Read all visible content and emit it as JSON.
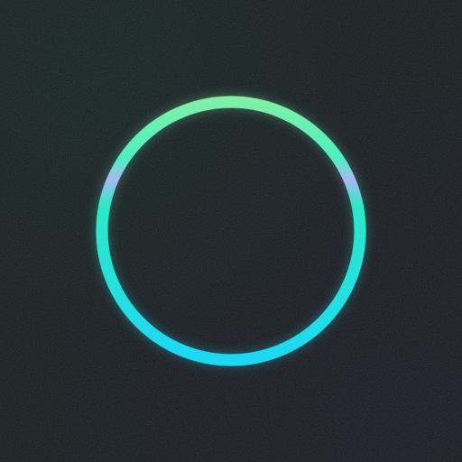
{
  "ring": {
    "icon": "ring-icon",
    "colors": {
      "top": "#7ef0a8",
      "upper_band": "#a8b8f0",
      "middle": "#2de8c6",
      "bottom": "#1ed8f2"
    }
  },
  "background": {
    "color": "#141a1d"
  }
}
